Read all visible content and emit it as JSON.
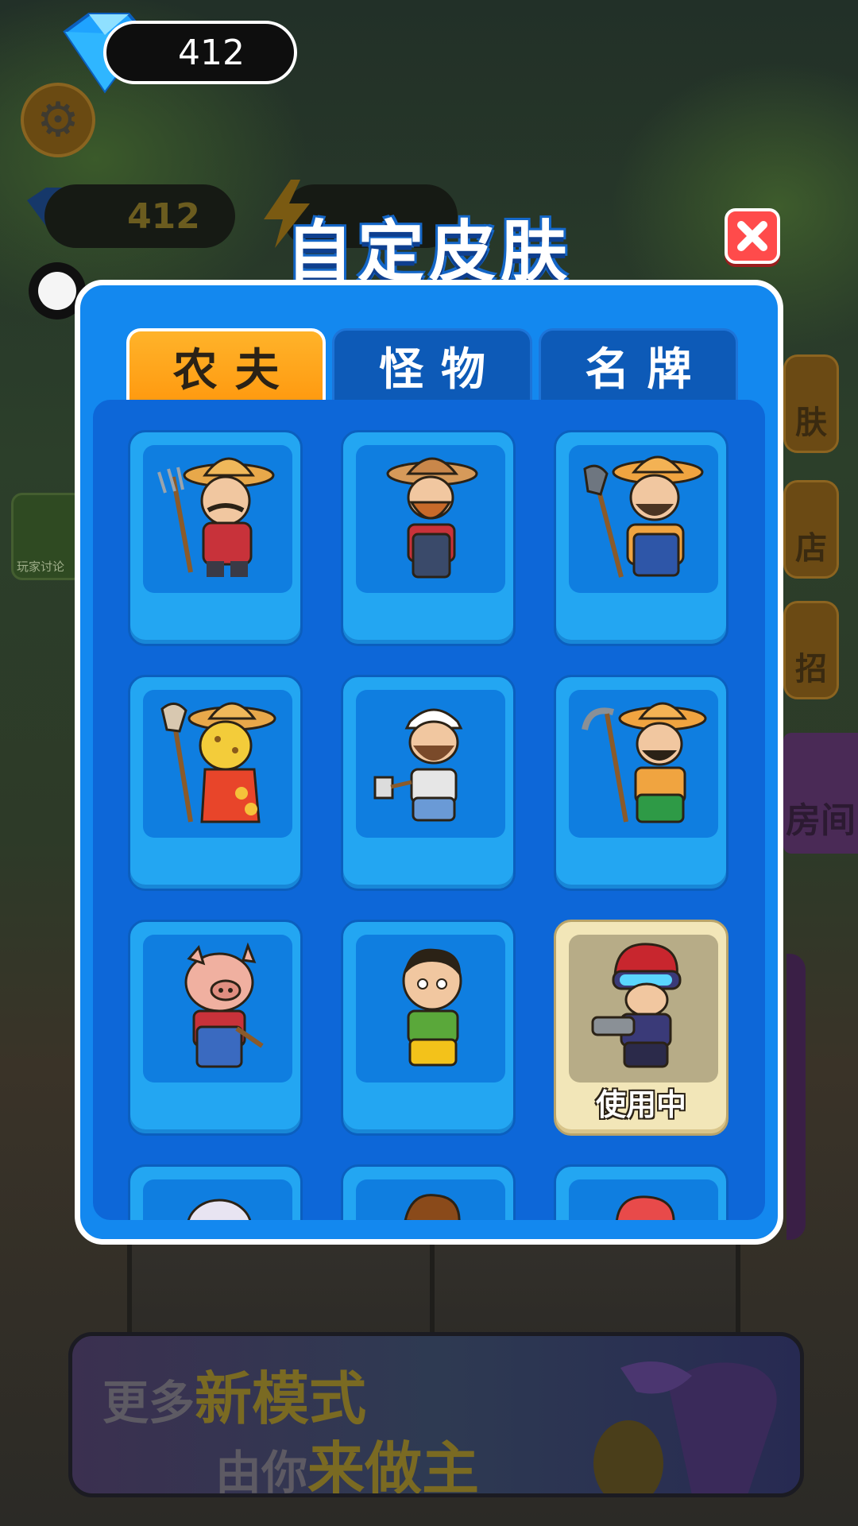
{
  "hud": {
    "gems_top": "412",
    "gems_secondary": "412"
  },
  "dialog": {
    "title": "自定皮肤",
    "tabs": [
      {
        "label": "农夫",
        "active": true
      },
      {
        "label": "怪物",
        "active": false
      },
      {
        "label": "名牌",
        "active": false
      }
    ],
    "skins": [
      {
        "name": "farmer-pitchfork"
      },
      {
        "name": "farmer-overalls"
      },
      {
        "name": "farmer-shovel"
      },
      {
        "name": "farmer-leopard"
      },
      {
        "name": "farmer-bandana"
      },
      {
        "name": "farmer-hoe"
      },
      {
        "name": "farmer-pig"
      },
      {
        "name": "farmer-boy"
      },
      {
        "name": "farmer-soldier",
        "status": "使用中"
      },
      {
        "name": "farmer-partial-1"
      },
      {
        "name": "farmer-partial-2"
      },
      {
        "name": "farmer-partial-3"
      }
    ]
  },
  "background": {
    "side_left_label": "玩家讨论",
    "side_right_labels": [
      "肤",
      "店",
      "招"
    ],
    "side_right_purple_label": "房间",
    "banner": {
      "line1_prefix": "更多",
      "line1_emph": "新模式",
      "line2_prefix": "由你",
      "line2_emph": "来做主"
    }
  },
  "colors": {
    "panel_blue": "#1388ef",
    "tab_active": "#ff9a10",
    "close_red": "#ff4b4b",
    "selected_cell": "#f2e6b8"
  }
}
